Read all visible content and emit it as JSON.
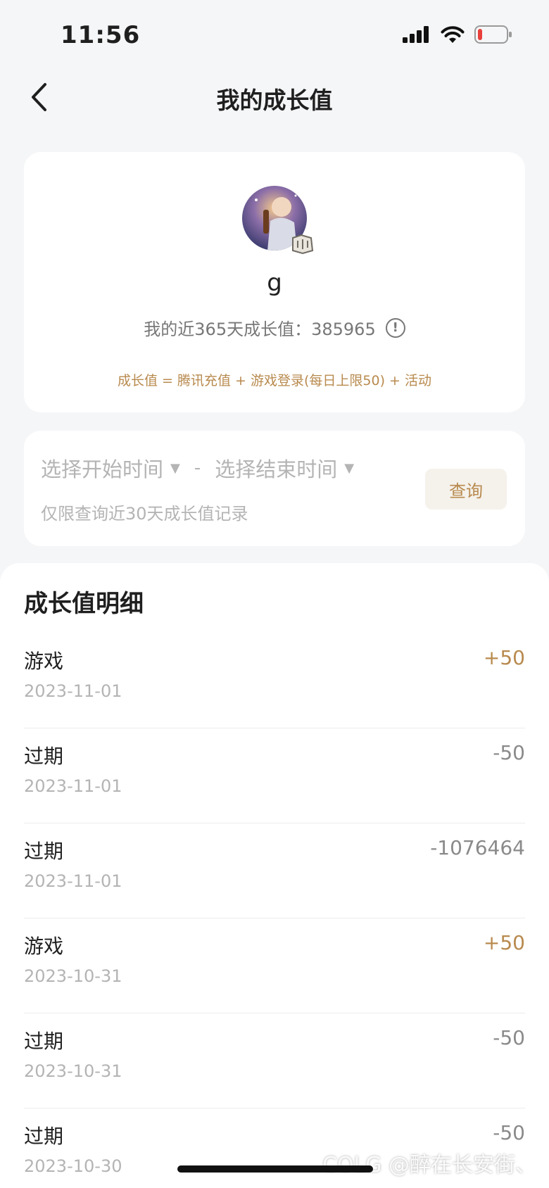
{
  "status": {
    "time": "11:56",
    "battery_color": "#e8403a"
  },
  "nav": {
    "title": "我的成长值",
    "back_icon": "chevron-left-icon"
  },
  "profile": {
    "username": "g",
    "growth_label": "我的近365天成长值：",
    "growth_value": "385965",
    "formula": "成长值 = 腾讯充值 + 游戏登录(每日上限50) + 活动"
  },
  "query": {
    "start_placeholder": "选择开始时间",
    "end_placeholder": "选择结束时间",
    "separator": "-",
    "hint": "仅限查询近30天成长值记录",
    "button_label": "查询"
  },
  "details": {
    "title": "成长值明细",
    "rows": [
      {
        "label": "游戏",
        "date": "2023-11-01",
        "amount": "+50",
        "positive": true
      },
      {
        "label": "过期",
        "date": "2023-11-01",
        "amount": "-50",
        "positive": false
      },
      {
        "label": "过期",
        "date": "2023-11-01",
        "amount": "-1076464",
        "positive": false
      },
      {
        "label": "游戏",
        "date": "2023-10-31",
        "amount": "+50",
        "positive": true
      },
      {
        "label": "过期",
        "date": "2023-10-31",
        "amount": "-50",
        "positive": false
      },
      {
        "label": "过期",
        "date": "2023-10-30",
        "amount": "-50",
        "positive": false
      }
    ]
  },
  "colors": {
    "accent": "#b88a4e",
    "muted": "#b4b4b4",
    "page_bg": "#f5f6f8"
  },
  "watermark": "COLG @醉在长安街、"
}
